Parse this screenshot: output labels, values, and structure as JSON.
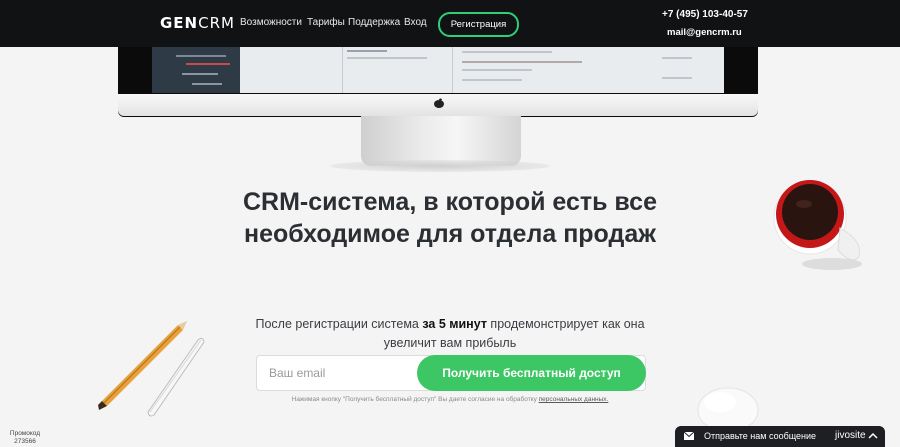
{
  "header": {
    "logo_bold": "GEN",
    "logo_light": "CRM",
    "nav": [
      "Возможности",
      "Тарифы",
      "Поддержка",
      "Вход"
    ],
    "register_label": "Регистрация",
    "phone": "+7 (495) 103-40-57",
    "email": "mail@gencrm.ru"
  },
  "hero": {
    "headline": "CRM-система, в которой есть все необходимое для отдела продаж",
    "sub_before": "После регистрации система ",
    "sub_bold": "за 5 минут",
    "sub_after": " продемонстрирует как она увеличит вам прибыль"
  },
  "signup": {
    "email_placeholder": "Ваш email",
    "cta_label": "Получить бесплатный доступ",
    "consent_before": "Нажимая кнопку \"Получить бесплатный доступ\" Вы даете согласие на обработку ",
    "consent_link": "персональных данных."
  },
  "promo": {
    "label": "Промокод",
    "code": "273566"
  },
  "chat": {
    "label": "Отправьте нам сообщение",
    "brand": "jivosite"
  },
  "colors": {
    "accent_green": "#3dc664",
    "header_bg": "#111214",
    "page_bg": "#f4f4f4"
  },
  "icons": [
    "apple-logo-icon",
    "envelope-icon",
    "chevron-up-icon"
  ]
}
